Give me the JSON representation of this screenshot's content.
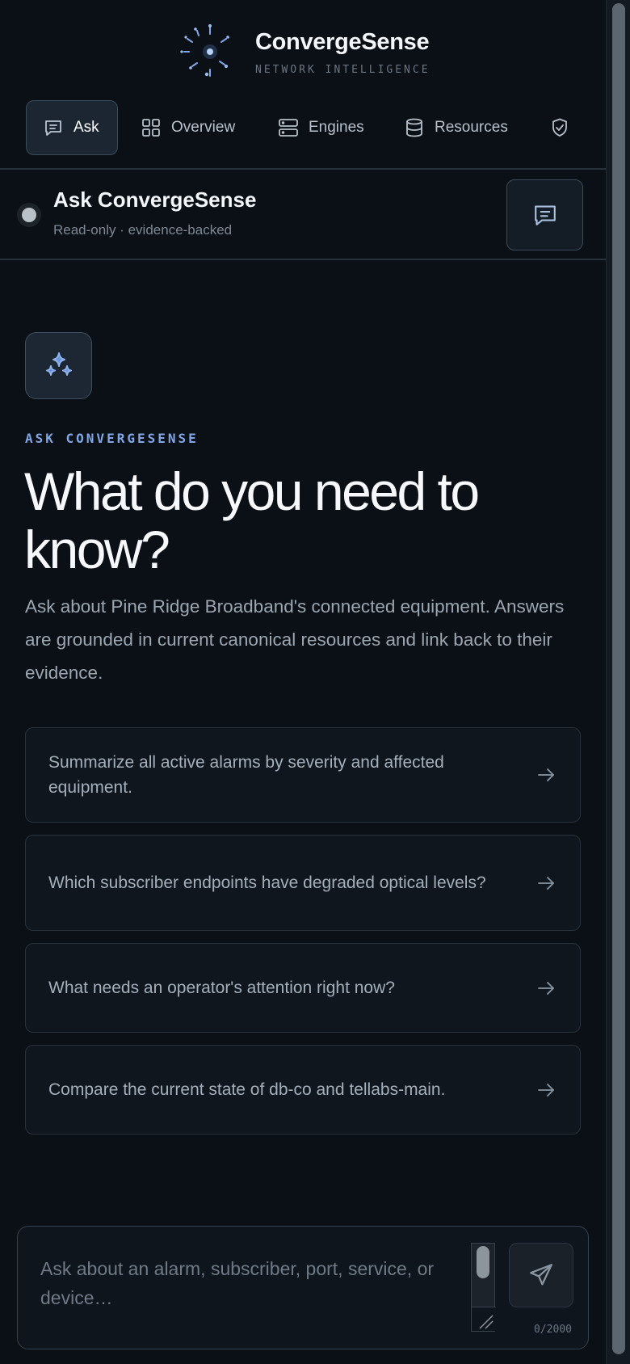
{
  "brand": {
    "title": "ConvergeSense",
    "subtitle": "NETWORK INTELLIGENCE",
    "icon": "starburst-logo"
  },
  "nav": {
    "items": [
      {
        "label": "Ask",
        "icon": "chat-icon",
        "active": true
      },
      {
        "label": "Overview",
        "icon": "grid-icon",
        "active": false
      },
      {
        "label": "Engines",
        "icon": "server-icon",
        "active": false
      },
      {
        "label": "Resources",
        "icon": "database-icon",
        "active": false
      },
      {
        "label": "",
        "icon": "shield-check-icon",
        "active": false
      }
    ]
  },
  "ask_bar": {
    "title": "Ask ConvergeSense",
    "subtitle": "Read-only · evidence-backed",
    "status_color": "#b9c1c9"
  },
  "hero": {
    "icon": "sparkles-icon",
    "eyebrow": "ASK CONVERGESENSE",
    "headline": "What do you need to know?",
    "intro": "Ask about Pine Ridge Broadband's connected equipment. Answers are grounded in current canonical resources and link back to their evidence."
  },
  "suggestions": [
    "Summarize all active alarms by severity and affected equipment.",
    "Which subscriber endpoints have degraded optical levels?",
    "What needs an operator's attention right now?",
    "Compare the current state of db-co and tellabs-main."
  ],
  "composer": {
    "placeholder": "Ask about an alarm, subscriber, port, service, or device…",
    "value": "",
    "counter": "0/2000"
  },
  "colors": {
    "background": "#0b1016",
    "accent": "#7fa6e6",
    "text": "#e6edf3",
    "muted": "#9ba6b1"
  }
}
